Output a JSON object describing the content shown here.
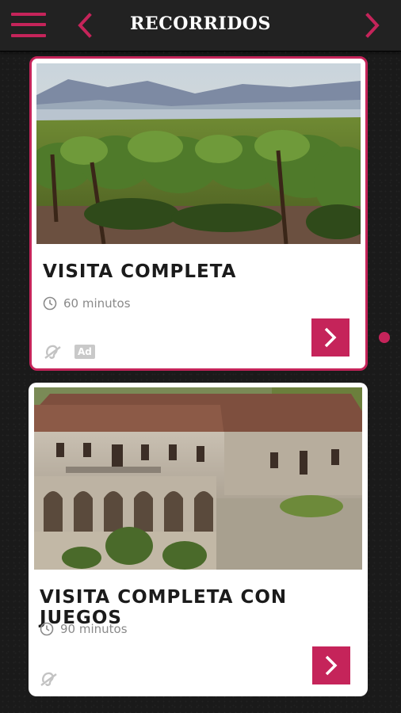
{
  "header": {
    "title": "RECORRIDOS",
    "menu_icon": "hamburger-menu-icon",
    "prev_icon": "chevron-left-icon",
    "next_icon": "chevron-right-icon"
  },
  "tours": [
    {
      "title": "VISITA COMPLETA",
      "duration": "60 minutos",
      "image": "vineyard-landscape",
      "accessibility": [
        "hearing-icon",
        "audio-description-badge"
      ],
      "ad_label": "Ad",
      "selected": true
    },
    {
      "title": "VISITA COMPLETA CON JUEGOS",
      "duration": "90 minutos",
      "image": "stone-manor-building",
      "accessibility": [
        "hearing-icon"
      ],
      "selected": false
    }
  ],
  "pager": {
    "current": 1,
    "total": 1
  },
  "colors": {
    "accent": "#c5245a",
    "topbar": "#222222",
    "background": "#1a1a1a",
    "card": "#ffffff"
  }
}
